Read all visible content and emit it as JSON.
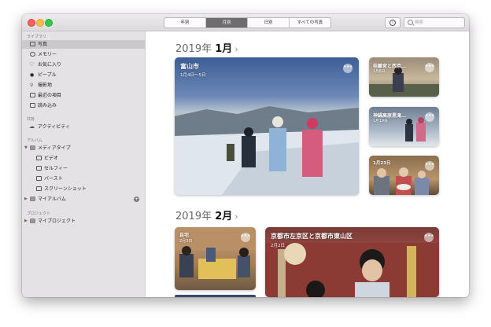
{
  "toolbar": {
    "tabs": [
      "年別",
      "月別",
      "日別",
      "すべての写真"
    ],
    "active_tab": "月別",
    "search_placeholder": "検索",
    "info_icon": "info-icon"
  },
  "sidebar": {
    "library_label": "ライブラリ",
    "library_items": [
      {
        "label": "写真",
        "icon": "photos-icon",
        "selected": true
      },
      {
        "label": "メモリー",
        "icon": "memories-icon"
      },
      {
        "label": "お気に入り",
        "icon": "heart-icon"
      },
      {
        "label": "ピープル",
        "icon": "person-icon"
      },
      {
        "label": "撮影地",
        "icon": "pin-icon"
      },
      {
        "label": "最近の項目",
        "icon": "clock-icon"
      },
      {
        "label": "読み込み",
        "icon": "import-icon"
      }
    ],
    "shared_label": "共有",
    "shared_items": [
      {
        "label": "アクティビティ",
        "icon": "cloud-icon"
      }
    ],
    "albums_label": "アルバム",
    "media_types": {
      "label": "メディアタイプ",
      "icon": "folder-icon"
    },
    "media_items": [
      {
        "label": "ビデオ",
        "icon": "video-icon"
      },
      {
        "label": "セルフィー",
        "icon": "selfie-icon"
      },
      {
        "label": "バースト",
        "icon": "burst-icon"
      },
      {
        "label": "スクリーンショット",
        "icon": "screenshot-icon"
      }
    ],
    "my_albums": {
      "label": "マイアルバム",
      "icon": "folder-icon"
    },
    "projects_label": "プロジェクト",
    "my_projects": {
      "label": "マイプロジェクト",
      "icon": "folder-icon"
    }
  },
  "main": {
    "sections": [
      {
        "year": "2019年",
        "month": "1月",
        "tiles": [
          {
            "title": "富山市",
            "date": "1月4日〜5日"
          },
          {
            "title": "桂離宮と西京…",
            "date": "1月6日"
          },
          {
            "title": "神鍋高原黒滝…",
            "date": "1月19日"
          },
          {
            "title": "",
            "date": "1月23日"
          }
        ]
      },
      {
        "year": "2019年",
        "month": "2月",
        "tiles": [
          {
            "title": "自宅",
            "date": "2月3日"
          },
          {
            "title": "京都市左京区と京都市東山区",
            "date": "2月2日"
          }
        ]
      }
    ]
  },
  "colors": {
    "active_tab": "#6d6c6e",
    "sidebar_bg": "#e4e2e4",
    "sidebar_selected": "#cbc9cb"
  }
}
